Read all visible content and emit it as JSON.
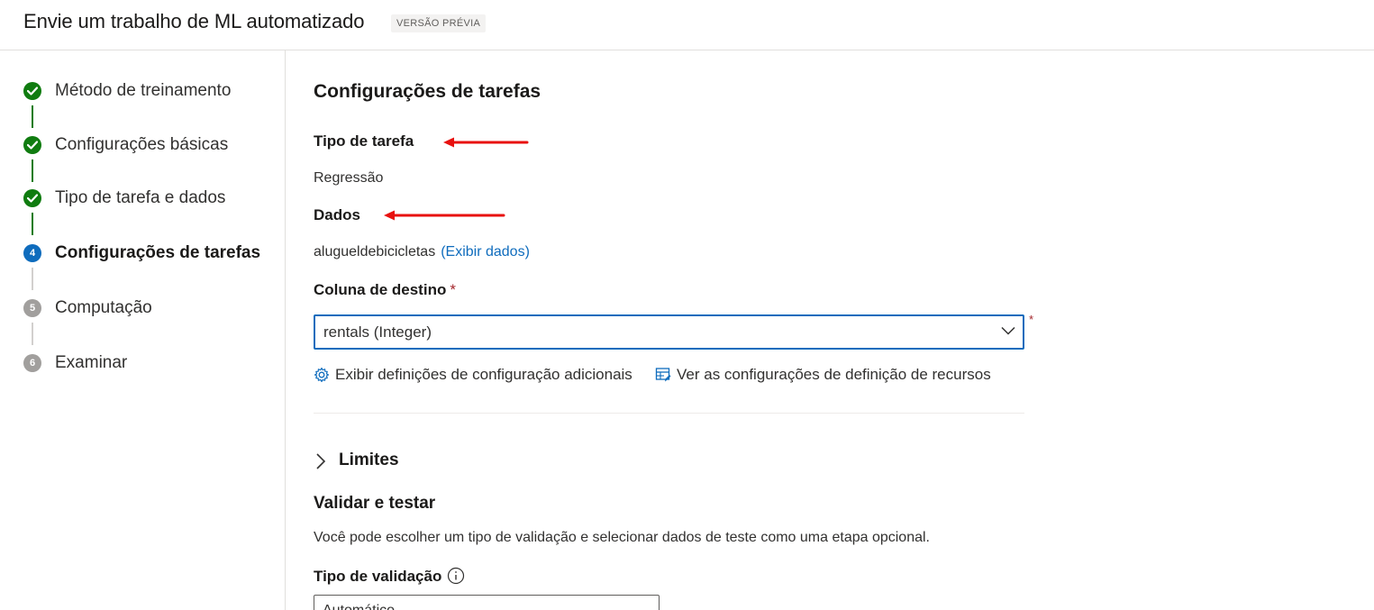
{
  "header": {
    "title": "Envie um trabalho de ML automatizado",
    "badge": "VERSÃO PRÉVIA"
  },
  "steps": [
    {
      "number": "1",
      "label": "Método de treinamento",
      "status": "done"
    },
    {
      "number": "2",
      "label": "Configurações básicas",
      "status": "done"
    },
    {
      "number": "3",
      "label": "Tipo de tarefa e dados",
      "status": "done"
    },
    {
      "number": "4",
      "label": "Configurações de tarefas",
      "status": "current"
    },
    {
      "number": "5",
      "label": "Computação",
      "status": "todo"
    },
    {
      "number": "6",
      "label": "Examinar",
      "status": "todo"
    }
  ],
  "main": {
    "section_title": "Configurações de tarefas",
    "task_type_label": "Tipo de tarefa",
    "task_type_value": "Regressão",
    "data_label": "Dados",
    "data_value": "alugueldebicicletas",
    "data_link": "(Exibir dados)",
    "target_label": "Coluna de destino",
    "required_marker": "*",
    "target_value": "rentals (Integer)",
    "action_additional": "Exibir definições de configuração adicionais",
    "action_features": "Ver as configurações de definição de recursos",
    "limits_label": "Limites",
    "validate_title": "Validar e testar",
    "validate_desc": "Você pode escolher um tipo de validação e selecionar dados de teste como uma etapa opcional.",
    "validation_type_label": "Tipo de validação",
    "validation_type_value": "Automático"
  },
  "colors": {
    "done": "#107c10",
    "current": "#0f6cbd",
    "todo": "#a19f9d",
    "annotation_arrow": "#e8110f"
  }
}
